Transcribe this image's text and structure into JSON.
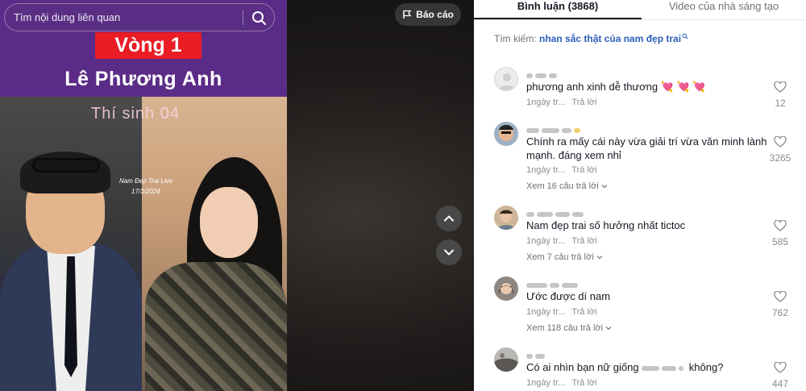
{
  "video": {
    "search_placeholder": "Tìm nội dung liên quan",
    "report_label": "Báo cáo",
    "overlay": {
      "round": "Vòng 1",
      "contestant_name": "Lê Phương Anh",
      "contestant_number": "Thí sinh 04",
      "watermark_title": "Nam Đẹp Trai Live",
      "watermark_date": "17/3/2024"
    }
  },
  "panel": {
    "tabs": [
      {
        "label": "Bình luận (3868)",
        "active": true
      },
      {
        "label": "Video của nhà sáng tạo",
        "active": false
      }
    ],
    "search_prefix": "Tìm kiếm:",
    "search_query": "nhan sắc thật của nam đẹp trai"
  },
  "comments": [
    {
      "text": "phương anh xinh dễ thương",
      "emoji": "💘 💘 💘",
      "time": "1ngày tr...",
      "reply": "Trả lời",
      "likes": "12",
      "replies": ""
    },
    {
      "text": "Chính ra mấy cái này vừa giải trí vừa văn minh lành mạnh. đáng xem nhỉ",
      "emoji": "",
      "time": "1ngày tr...",
      "reply": "Trả lời",
      "likes": "3265",
      "replies": "Xem 16 câu trả lời"
    },
    {
      "text": "Nam đẹp trai số hưởng nhất tictoc",
      "emoji": "",
      "time": "1ngày tr...",
      "reply": "Trả lời",
      "likes": "585",
      "replies": "Xem 7 câu trả lời"
    },
    {
      "text": "Ước được dí nam",
      "emoji": "",
      "time": "1ngày tr...",
      "reply": "Trả lời",
      "likes": "762",
      "replies": "Xem 118 câu trả lời"
    },
    {
      "text_before": "Có ai nhìn bạn nữ giống",
      "text_after": "không?",
      "time": "1ngày tr...",
      "reply": "Trả lời",
      "likes": "447",
      "replies": ""
    }
  ],
  "colors": {
    "video_purple": "#5b2c87",
    "round_red": "#ea1c24",
    "link_blue": "#2b5db9",
    "text_dark": "#161823",
    "text_muted": "#8a8b91"
  }
}
